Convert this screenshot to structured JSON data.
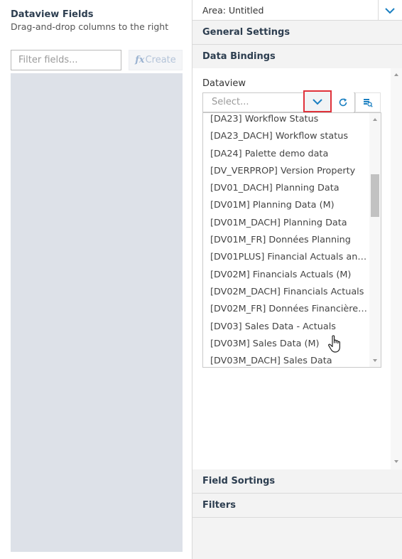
{
  "left_panel": {
    "title": "Dataview Fields",
    "subtitle": "Drag-and-drop columns to the right",
    "filter_placeholder": "Filter fields...",
    "create_label": "Create",
    "create_icon": "fx"
  },
  "right_panel": {
    "area_label": "Area: Untitled",
    "sections": {
      "general": "General Settings",
      "bindings": "Data Bindings",
      "sortings": "Field Sortings",
      "filters": "Filters"
    },
    "dataview_label": "Dataview",
    "select_placeholder": "Select...",
    "dataview_options": [
      "[DA23] Workflow Status",
      "[DA23_DACH] Workflow status",
      "[DA24] Palette demo data",
      "[DV_VERPROP] Version Property",
      "[DV01_DACH] Planning Data",
      "[DV01M] Planning Data (M)",
      "[DV01M_DACH] Planning Data",
      "[DV01M_FR] Données Planning",
      "[DV01PLUS] Financial Actuals and ...",
      "[DV02M] Financials Actuals (M)",
      "[DV02M_DACH] Financials Actuals",
      "[DV02M_FR] Données Financières...",
      "[DV03] Sales Data - Actuals",
      "[DV03M] Sales Data (M)",
      "[DV03M_DACH] Sales Data"
    ]
  },
  "colors": {
    "accent": "#1a7fc1",
    "highlight": "#e0313a",
    "fields_area": "#dde1e8"
  }
}
